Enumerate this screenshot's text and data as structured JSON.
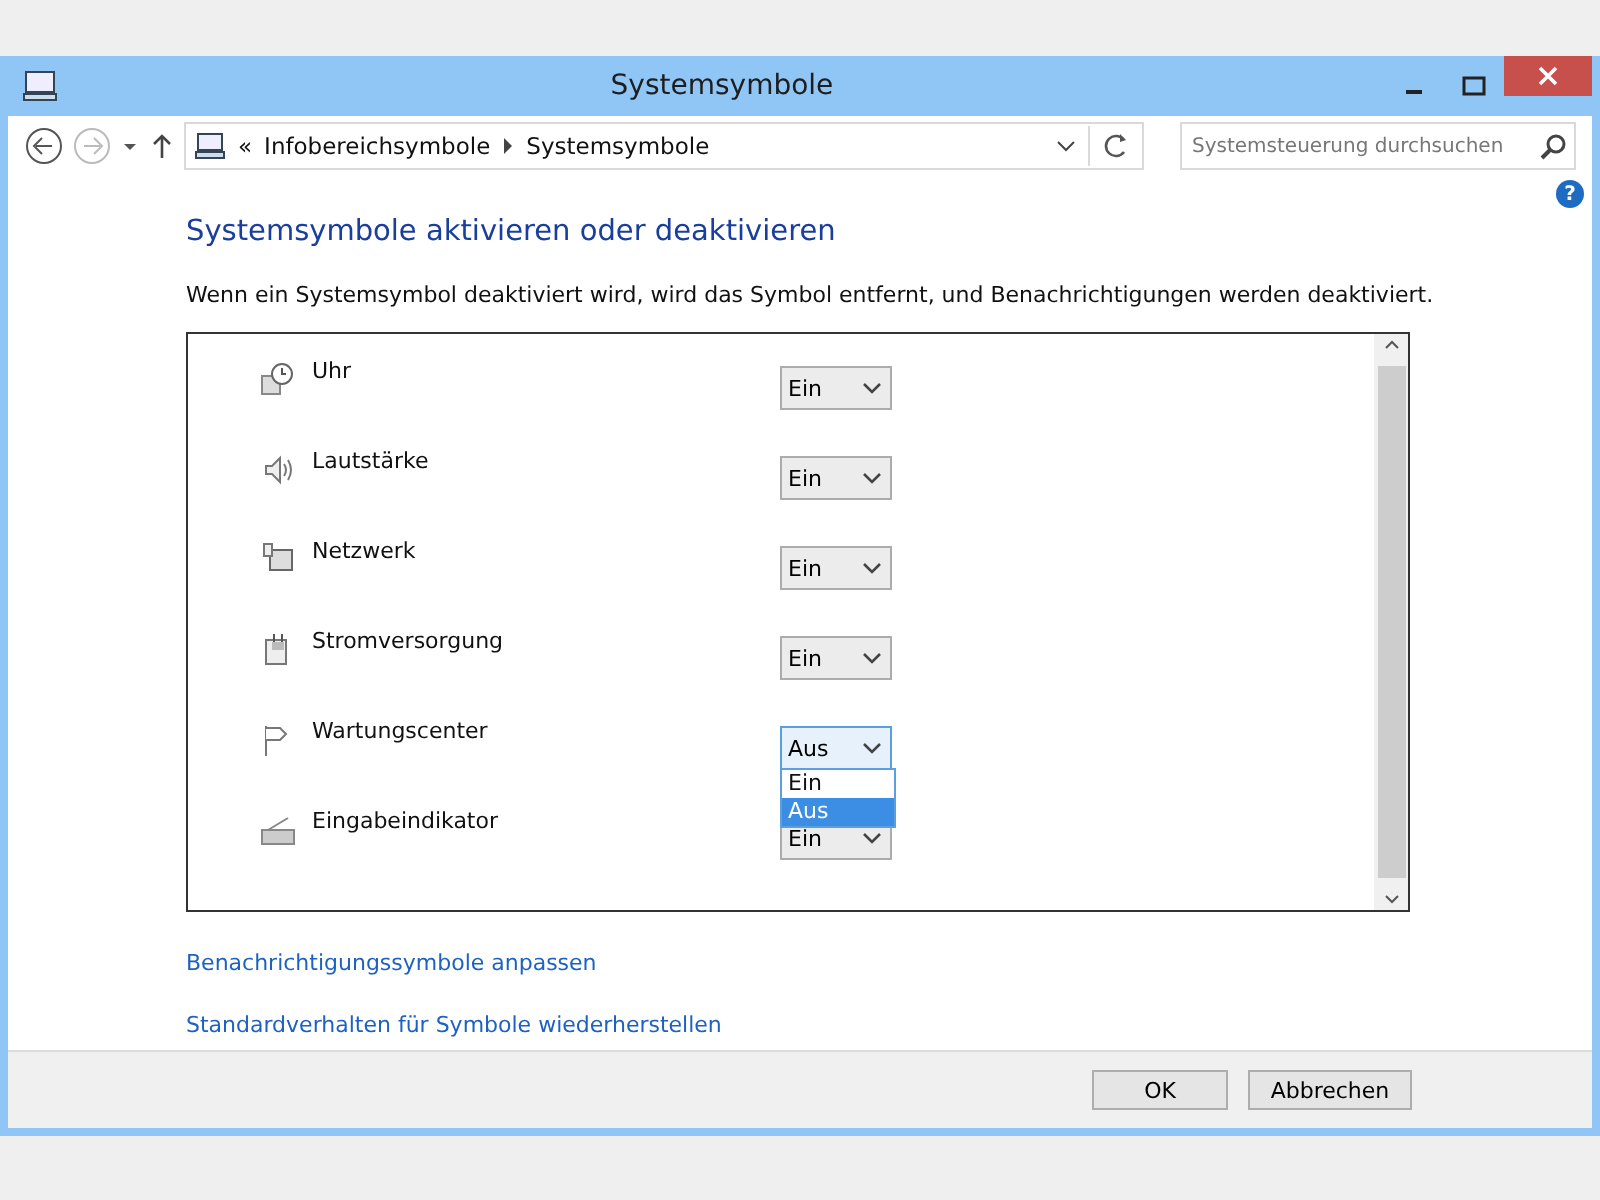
{
  "window": {
    "title": "Systemsymbole"
  },
  "address_bar": {
    "path": [
      "Infobereichsymbole",
      "Systemsymbole"
    ],
    "overflow": "«"
  },
  "search": {
    "placeholder": "Systemsteuerung durchsuchen"
  },
  "help": "?",
  "heading": "Systemsymbole aktivieren oder deaktivieren",
  "description": "Wenn ein Systemsymbol deaktiviert wird, wird das Symbol entfernt, und Benachrichtigungen werden deaktiviert.",
  "rows": [
    {
      "kind": "clock",
      "label": "Uhr",
      "value": "Ein",
      "open": false
    },
    {
      "kind": "speaker",
      "label": "Lautstärke",
      "value": "Ein",
      "open": false
    },
    {
      "kind": "network",
      "label": "Netzwerk",
      "value": "Ein",
      "open": false
    },
    {
      "kind": "power",
      "label": "Stromversorgung",
      "value": "Ein",
      "open": false
    },
    {
      "kind": "flag",
      "label": "Wartungscenter",
      "value": "Aus",
      "open": true,
      "options": [
        {
          "label": "Ein",
          "selected": false
        },
        {
          "label": "Aus",
          "selected": true
        }
      ]
    },
    {
      "kind": "keyboard",
      "label": "Eingabeindikator",
      "value": "Ein",
      "open": false
    }
  ],
  "links": [
    "Benachrichtigungssymbole anpassen",
    "Standardverhalten für Symbole wiederherstellen"
  ],
  "buttons": [
    "OK",
    "Abbrechen"
  ]
}
